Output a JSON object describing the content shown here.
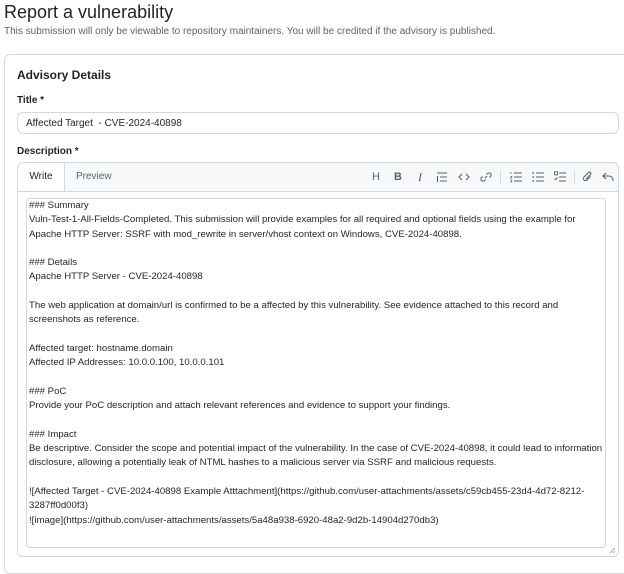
{
  "page": {
    "title": "Report a vulnerability",
    "subtitle": "This submission will only be viewable to repository maintainers. You will be credited if the advisory is published."
  },
  "advisory": {
    "section_title": "Advisory Details",
    "title_label": "Title *",
    "title_value": "Affected Target  - CVE-2024-40898",
    "description_label": "Description *"
  },
  "editor": {
    "tabs": [
      "Write",
      "Preview"
    ],
    "toolbar_icons": [
      "heading-icon",
      "bold-icon",
      "italic-icon",
      "quote-icon",
      "code-icon",
      "link-icon",
      "ordered-list-icon",
      "unordered-list-icon",
      "task-list-icon",
      "attach-icon",
      "undo-icon"
    ],
    "toolbar_glyphs": {
      "heading": "H",
      "bold": "B",
      "italic": "I"
    },
    "lines": [
      "### Summary",
      "Vuln-Test-1-All-Fields-Completed. This submission will provide examples for all required and optional fields using the example for",
      "Apache HTTP Server: SSRF with mod_rewrite in server/vhost context on Windows, CVE-2024-40898.",
      "",
      "### Details",
      "Apache HTTP Server - CVE-2024-40898",
      "",
      "The web application at domain/url is confirmed to be a affected by this vulnerability. See evidence attached to this record and",
      "screenshots as reference.",
      "",
      "Affected target: hostname.domain",
      "Affected IP Addresses: 10.0.0.100, 10.0.0.101",
      "",
      "### PoC",
      "Provide your PoC description and attach relevant references and evidence to support your findings.",
      "",
      "### Impact",
      "Be descriptive. Consider the scope and potential impact of the vulnerability. In the case of CVE-2024-40898, it could lead to information",
      "disclosure, allowing a potentially leak of NTML hashes to a malicious server via SSRF and malicious requests.",
      "",
      "![Affected Target - CVE-2024-40898 Example Atttachment](https://github.com/user-attachments/assets/c59cb455-23d4-4d72-8212-",
      "3287ff0d00f3)",
      "![image](https://github.com/user-attachments/assets/5a48a938-6920-48a2-9d2b-14904d270db3)"
    ]
  }
}
